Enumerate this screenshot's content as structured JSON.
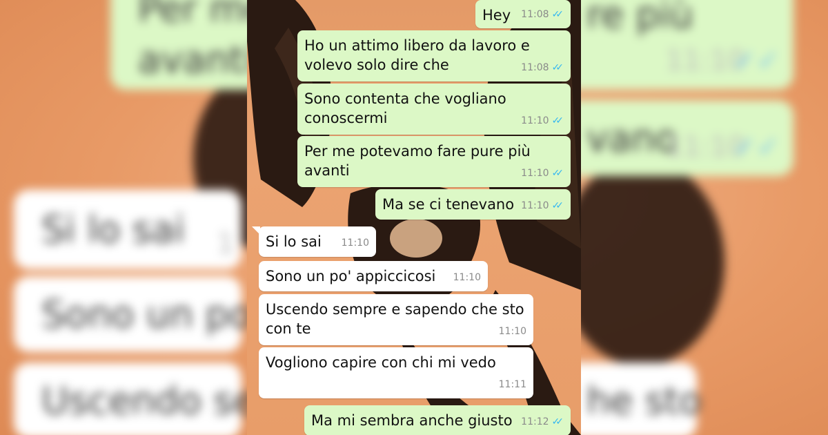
{
  "chat": {
    "messages": [
      {
        "dir": "out",
        "text": "Hey",
        "time": "11:08",
        "read": true
      },
      {
        "dir": "out",
        "text": "Ho un attimo libero da lavoro e\nvolevo solo dire che",
        "time": "11:08",
        "read": true
      },
      {
        "dir": "out",
        "text": "Sono contenta che vogliano\nconoscermi",
        "time": "11:10",
        "read": true
      },
      {
        "dir": "out",
        "text": "Per me potevamo fare pure più\navanti",
        "time": "11:10",
        "read": true
      },
      {
        "dir": "out",
        "text": "Ma se ci tenevano",
        "time": "11:10",
        "read": true
      },
      {
        "dir": "in",
        "text": "Si lo sai",
        "time": "11:10"
      },
      {
        "dir": "in",
        "text": "Sono un po' appiccicosi",
        "time": "11:10"
      },
      {
        "dir": "in",
        "text": "Uscendo sempre e sapendo che sto\ncon te",
        "time": "11:10"
      },
      {
        "dir": "in",
        "text": "Vogliono capire con chi mi vedo",
        "time": "11:11"
      },
      {
        "dir": "out",
        "text": "Ma mi sembra anche giusto",
        "time": "11:12",
        "read": true
      }
    ],
    "tick_glyph": "✓✓",
    "colors": {
      "outgoing_bubble": "#dcf8c6",
      "incoming_bubble": "#ffffff",
      "read_tick": "#34b7f1",
      "background": "#e89d69"
    }
  },
  "background_blur": {
    "fragments": [
      {
        "kind": "out",
        "text": "Per me",
        "time": "",
        "tick": false
      },
      {
        "kind": "out",
        "text": "avanti",
        "time": "",
        "tick": false
      },
      {
        "kind": "out",
        "text": "re più",
        "time": "",
        "tick": false
      },
      {
        "kind": "out",
        "text": "",
        "time": "11:10",
        "tick": true
      },
      {
        "kind": "out",
        "text": "vano",
        "time": "11:10",
        "tick": true
      },
      {
        "kind": "in",
        "text": "Si lo sai",
        "time": "1",
        "tick": false
      },
      {
        "kind": "in",
        "text": "Sono un po'",
        "time": "",
        "tick": false
      },
      {
        "kind": "in",
        "text": "Uscendo se",
        "time": "",
        "tick": false
      },
      {
        "kind": "in",
        "text": "he sto",
        "time": "",
        "tick": false
      }
    ]
  }
}
